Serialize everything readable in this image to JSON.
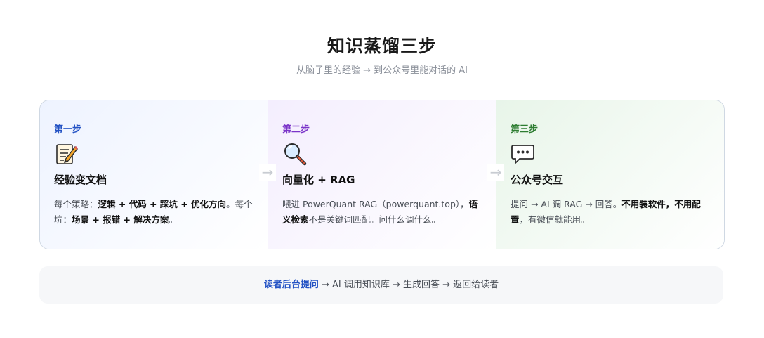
{
  "header": {
    "title": "知识蒸馏三步",
    "subtitle": "从脑子里的经验 → 到公众号里能对话的 AI"
  },
  "steps": [
    {
      "label": "第一步",
      "icon": "memo-icon",
      "title": "经验变文档",
      "desc": [
        {
          "t": "每个策略：",
          "b": false
        },
        {
          "t": "逻辑 + 代码 + 踩坑 + 优化方向",
          "b": true
        },
        {
          "t": "。每个坑：",
          "b": false
        },
        {
          "t": "场景 + 报错 + 解决方案",
          "b": true
        },
        {
          "t": "。",
          "b": false
        }
      ]
    },
    {
      "label": "第二步",
      "icon": "magnifier-icon",
      "title": "向量化 + RAG",
      "desc": [
        {
          "t": "喂进 PowerQuant RAG（powerquant.top），",
          "b": false
        },
        {
          "t": "语义检索",
          "b": true
        },
        {
          "t": "不是关键词匹配。问什么调什么。",
          "b": false
        }
      ]
    },
    {
      "label": "第三步",
      "icon": "speech-bubble-icon",
      "title": "公众号交互",
      "desc": [
        {
          "t": "提问 → AI 调 RAG → 回答。",
          "b": false
        },
        {
          "t": "不用装软件，不用配置",
          "b": true
        },
        {
          "t": "，有微信就能用。",
          "b": false
        }
      ]
    }
  ],
  "arrows": [
    "→",
    "→"
  ],
  "flow": {
    "highlight": "读者后台提问",
    "rest": " → AI 调用知识库 → 生成回答 → 返回给读者"
  },
  "colors": {
    "step1_accent": "#2352c4",
    "step2_accent": "#7b35c9",
    "step3_accent": "#2e7d32"
  }
}
